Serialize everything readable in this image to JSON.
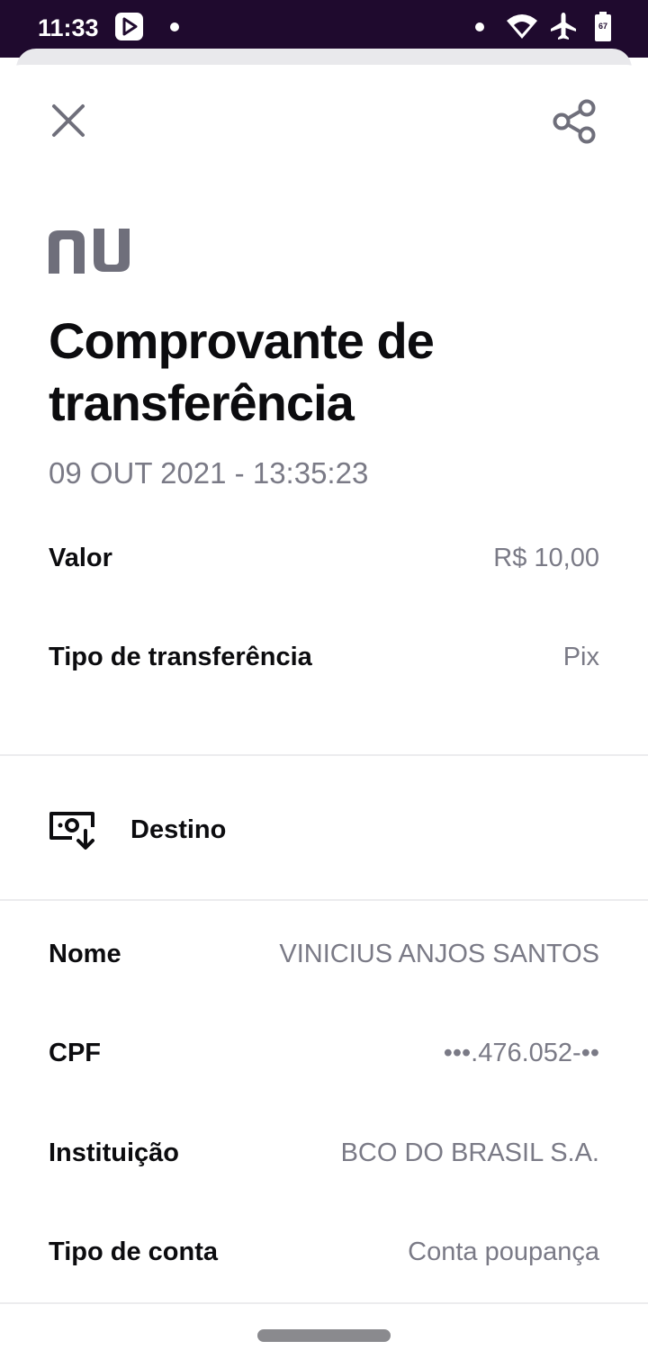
{
  "status_bar": {
    "time": "11:33",
    "battery_level": "67"
  },
  "header": {
    "close_icon": "close-icon",
    "share_icon": "share-icon"
  },
  "brand": {
    "logo": "nu",
    "color": "#6f6f7b"
  },
  "receipt": {
    "title": "Comprovante de transferência",
    "datetime": "09 OUT 2021 - 13:35:23",
    "details": [
      {
        "label": "Valor",
        "value": "R$ 10,00"
      },
      {
        "label": "Tipo de transferência",
        "value": "Pix"
      }
    ]
  },
  "destination": {
    "section_title": "Destino",
    "section_icon": "receive-money-icon",
    "fields": [
      {
        "label": "Nome",
        "value": "VINICIUS ANJOS SANTOS"
      },
      {
        "label": "CPF",
        "value": "•••.476.052-••"
      },
      {
        "label": "Instituição",
        "value": "BCO DO BRASIL S.A."
      },
      {
        "label": "Tipo de conta",
        "value": "Conta poupança"
      }
    ]
  },
  "colors": {
    "status_bar_bg": "#1f0a2e",
    "text_primary": "#0c0c0f",
    "text_secondary": "#7a7a86"
  }
}
